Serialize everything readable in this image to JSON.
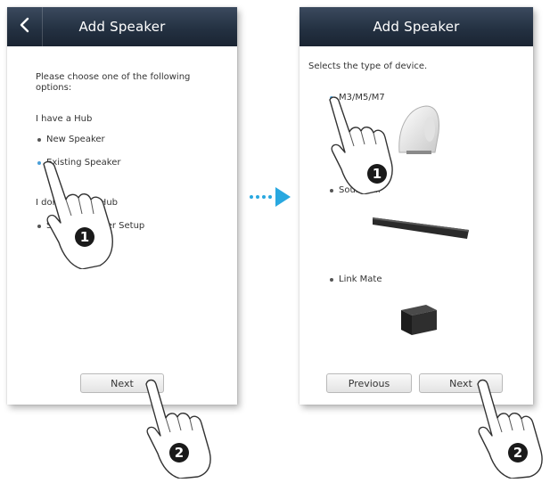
{
  "arrow_color": "#29a8e0",
  "accent_color": "#4a9fd8",
  "left_screen": {
    "title": "Add Speaker",
    "back_icon": "chevron-left-icon",
    "instruction": "Please choose one of the following options:",
    "group1_heading": "I have a Hub",
    "group1_options": [
      "New Speaker",
      "Existing Speaker"
    ],
    "group2_heading": "I don't have a Hub",
    "group2_options": [
      "Simple Speaker Setup"
    ],
    "next_label": "Next",
    "callout_1": "1",
    "callout_2": "2"
  },
  "right_screen": {
    "title": "Add Speaker",
    "instruction": "Selects the type of device.",
    "options": [
      "M3/M5/M7",
      "Soundbar",
      "Link Mate"
    ],
    "previous_label": "Previous",
    "next_label": "Next",
    "callout_1": "1",
    "callout_2": "2"
  }
}
